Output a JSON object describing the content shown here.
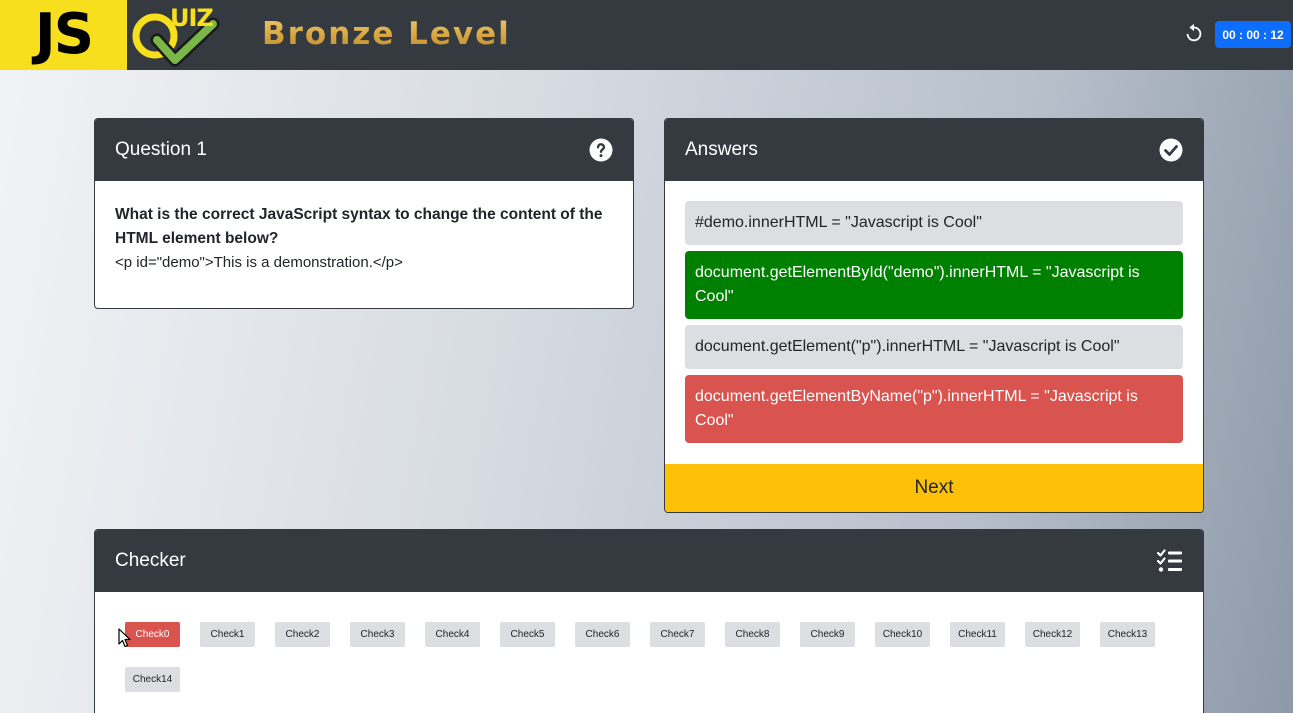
{
  "header": {
    "logo_js": "JS",
    "logo_quiz": "UIZ",
    "level_title": "Bronze Level",
    "reset_icon": "reset-icon",
    "timer": "00 : 00 : 12",
    "colors": {
      "bar": "#343a40",
      "js_yellow": "#f7df1e",
      "timer_blue": "#0d6efd",
      "gold": "#d6a43e"
    }
  },
  "question": {
    "title": "Question 1",
    "icon": "question-circle-icon",
    "text": "What is the correct JavaScript syntax to change the content of the HTML element below?",
    "code": "<p id=\"demo\">This is a demonstration.</p>"
  },
  "answers": {
    "title": "Answers",
    "icon": "check-circle-icon",
    "options": [
      {
        "text": "#demo.innerHTML = \"Javascript is Cool\"",
        "state": "plain"
      },
      {
        "text": "document.getElementById(\"demo\").innerHTML = \"Javascript is Cool\"",
        "state": "correct"
      },
      {
        "text": "document.getElement(\"p\").innerHTML = \"Javascript is Cool\"",
        "state": "plain"
      },
      {
        "text": "document.getElementByName(\"p\").innerHTML = \"Javascript is Cool\"",
        "state": "wrong"
      }
    ],
    "next_label": "Next",
    "colors": {
      "correct": "#008000",
      "wrong": "#d9534f",
      "plain": "#dcdee1",
      "next": "#ffc107"
    }
  },
  "checker": {
    "title": "Checker",
    "icon": "checklist-icon",
    "items": [
      {
        "label": "Check0",
        "state": "wrong"
      },
      {
        "label": "Check1",
        "state": "plain"
      },
      {
        "label": "Check2",
        "state": "plain"
      },
      {
        "label": "Check3",
        "state": "plain"
      },
      {
        "label": "Check4",
        "state": "plain"
      },
      {
        "label": "Check5",
        "state": "plain"
      },
      {
        "label": "Check6",
        "state": "plain"
      },
      {
        "label": "Check7",
        "state": "plain"
      },
      {
        "label": "Check8",
        "state": "plain"
      },
      {
        "label": "Check9",
        "state": "plain"
      },
      {
        "label": "Check10",
        "state": "plain"
      },
      {
        "label": "Check11",
        "state": "plain"
      },
      {
        "label": "Check12",
        "state": "plain"
      },
      {
        "label": "Check13",
        "state": "plain"
      },
      {
        "label": "Check14",
        "state": "plain"
      }
    ]
  }
}
